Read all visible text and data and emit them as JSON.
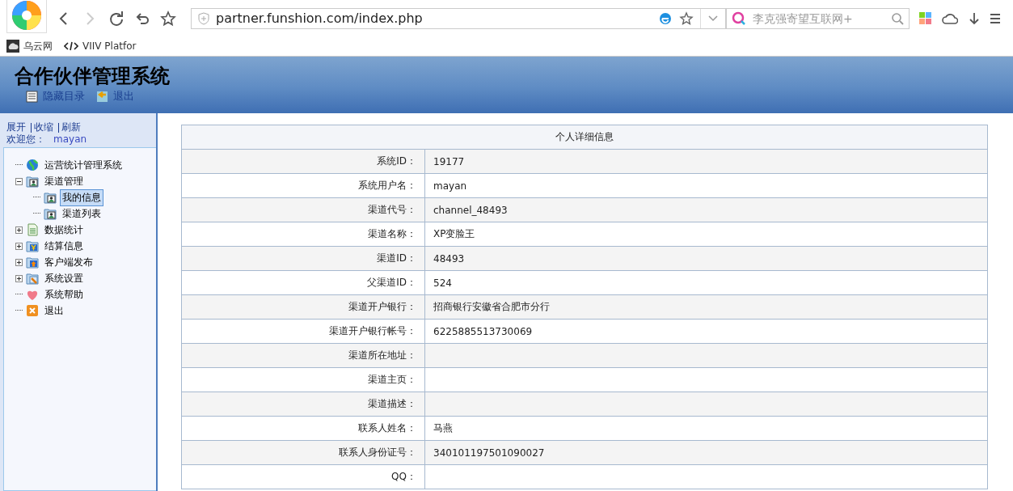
{
  "browser": {
    "nav": [
      {
        "kind": "back",
        "disabled": false
      },
      {
        "kind": "forward",
        "disabled": true
      },
      {
        "kind": "reload",
        "disabled": false
      },
      {
        "kind": "undo",
        "disabled": false
      },
      {
        "kind": "star",
        "disabled": false
      }
    ],
    "address": {
      "value": "partner.funshion.com/index.php"
    },
    "search": {
      "placeholder": "李克强寄望互联网+"
    },
    "bookmarks": [
      {
        "kind": "cloud",
        "label": "乌云网"
      },
      {
        "kind": "code",
        "label": "VIIV Platfor"
      }
    ]
  },
  "header": {
    "title": "合作伙伴管理系统",
    "links": [
      {
        "kind": "list",
        "label": "隐藏目录"
      },
      {
        "kind": "exit",
        "label": "退出"
      }
    ]
  },
  "sidebar": {
    "actions": [
      "展开",
      "收缩",
      "刷新"
    ],
    "welcome": "欢迎您：",
    "user": "mayan",
    "tree": [
      {
        "label": "运营统计管理系统",
        "kind": "globe",
        "selected": false
      },
      {
        "label": "渠道管理",
        "kind": "person",
        "expanded": true,
        "selected": false,
        "children": [
          {
            "label": "我的信息",
            "kind": "person",
            "selected": true
          },
          {
            "label": "渠道列表",
            "kind": "person",
            "selected": false
          }
        ]
      },
      {
        "label": "数据统计",
        "kind": "doc",
        "expanded": false,
        "selected": false
      },
      {
        "label": "结算信息",
        "kind": "yen",
        "expanded": false,
        "selected": false
      },
      {
        "label": "客户端发布",
        "kind": "upload",
        "expanded": false,
        "selected": false
      },
      {
        "label": "系统设置",
        "kind": "wrench",
        "expanded": false,
        "selected": false
      },
      {
        "label": "系统帮助",
        "kind": "heart",
        "selected": false
      },
      {
        "label": "退出",
        "kind": "close",
        "selected": false
      }
    ]
  },
  "details": {
    "title": "个人详细信息",
    "rows": [
      {
        "label": "系统ID：",
        "value": "19177"
      },
      {
        "label": "系统用户名：",
        "value": "mayan"
      },
      {
        "label": "渠道代号：",
        "value": "channel_48493"
      },
      {
        "label": "渠道名称：",
        "value": "XP变脸王"
      },
      {
        "label": "渠道ID：",
        "value": "48493"
      },
      {
        "label": "父渠道ID：",
        "value": "524"
      },
      {
        "label": "渠道开户银行：",
        "value": "招商银行安徽省合肥市分行"
      },
      {
        "label": "渠道开户银行帐号：",
        "value": "6225885513730069"
      },
      {
        "label": "渠道所在地址：",
        "value": ""
      },
      {
        "label": "渠道主页：",
        "value": ""
      },
      {
        "label": "渠道描述：",
        "value": ""
      },
      {
        "label": "联系人姓名：",
        "value": "马燕"
      },
      {
        "label": "联系人身份证号：",
        "value": "340101197501090027"
      },
      {
        "label": "QQ：",
        "value": ""
      }
    ]
  }
}
